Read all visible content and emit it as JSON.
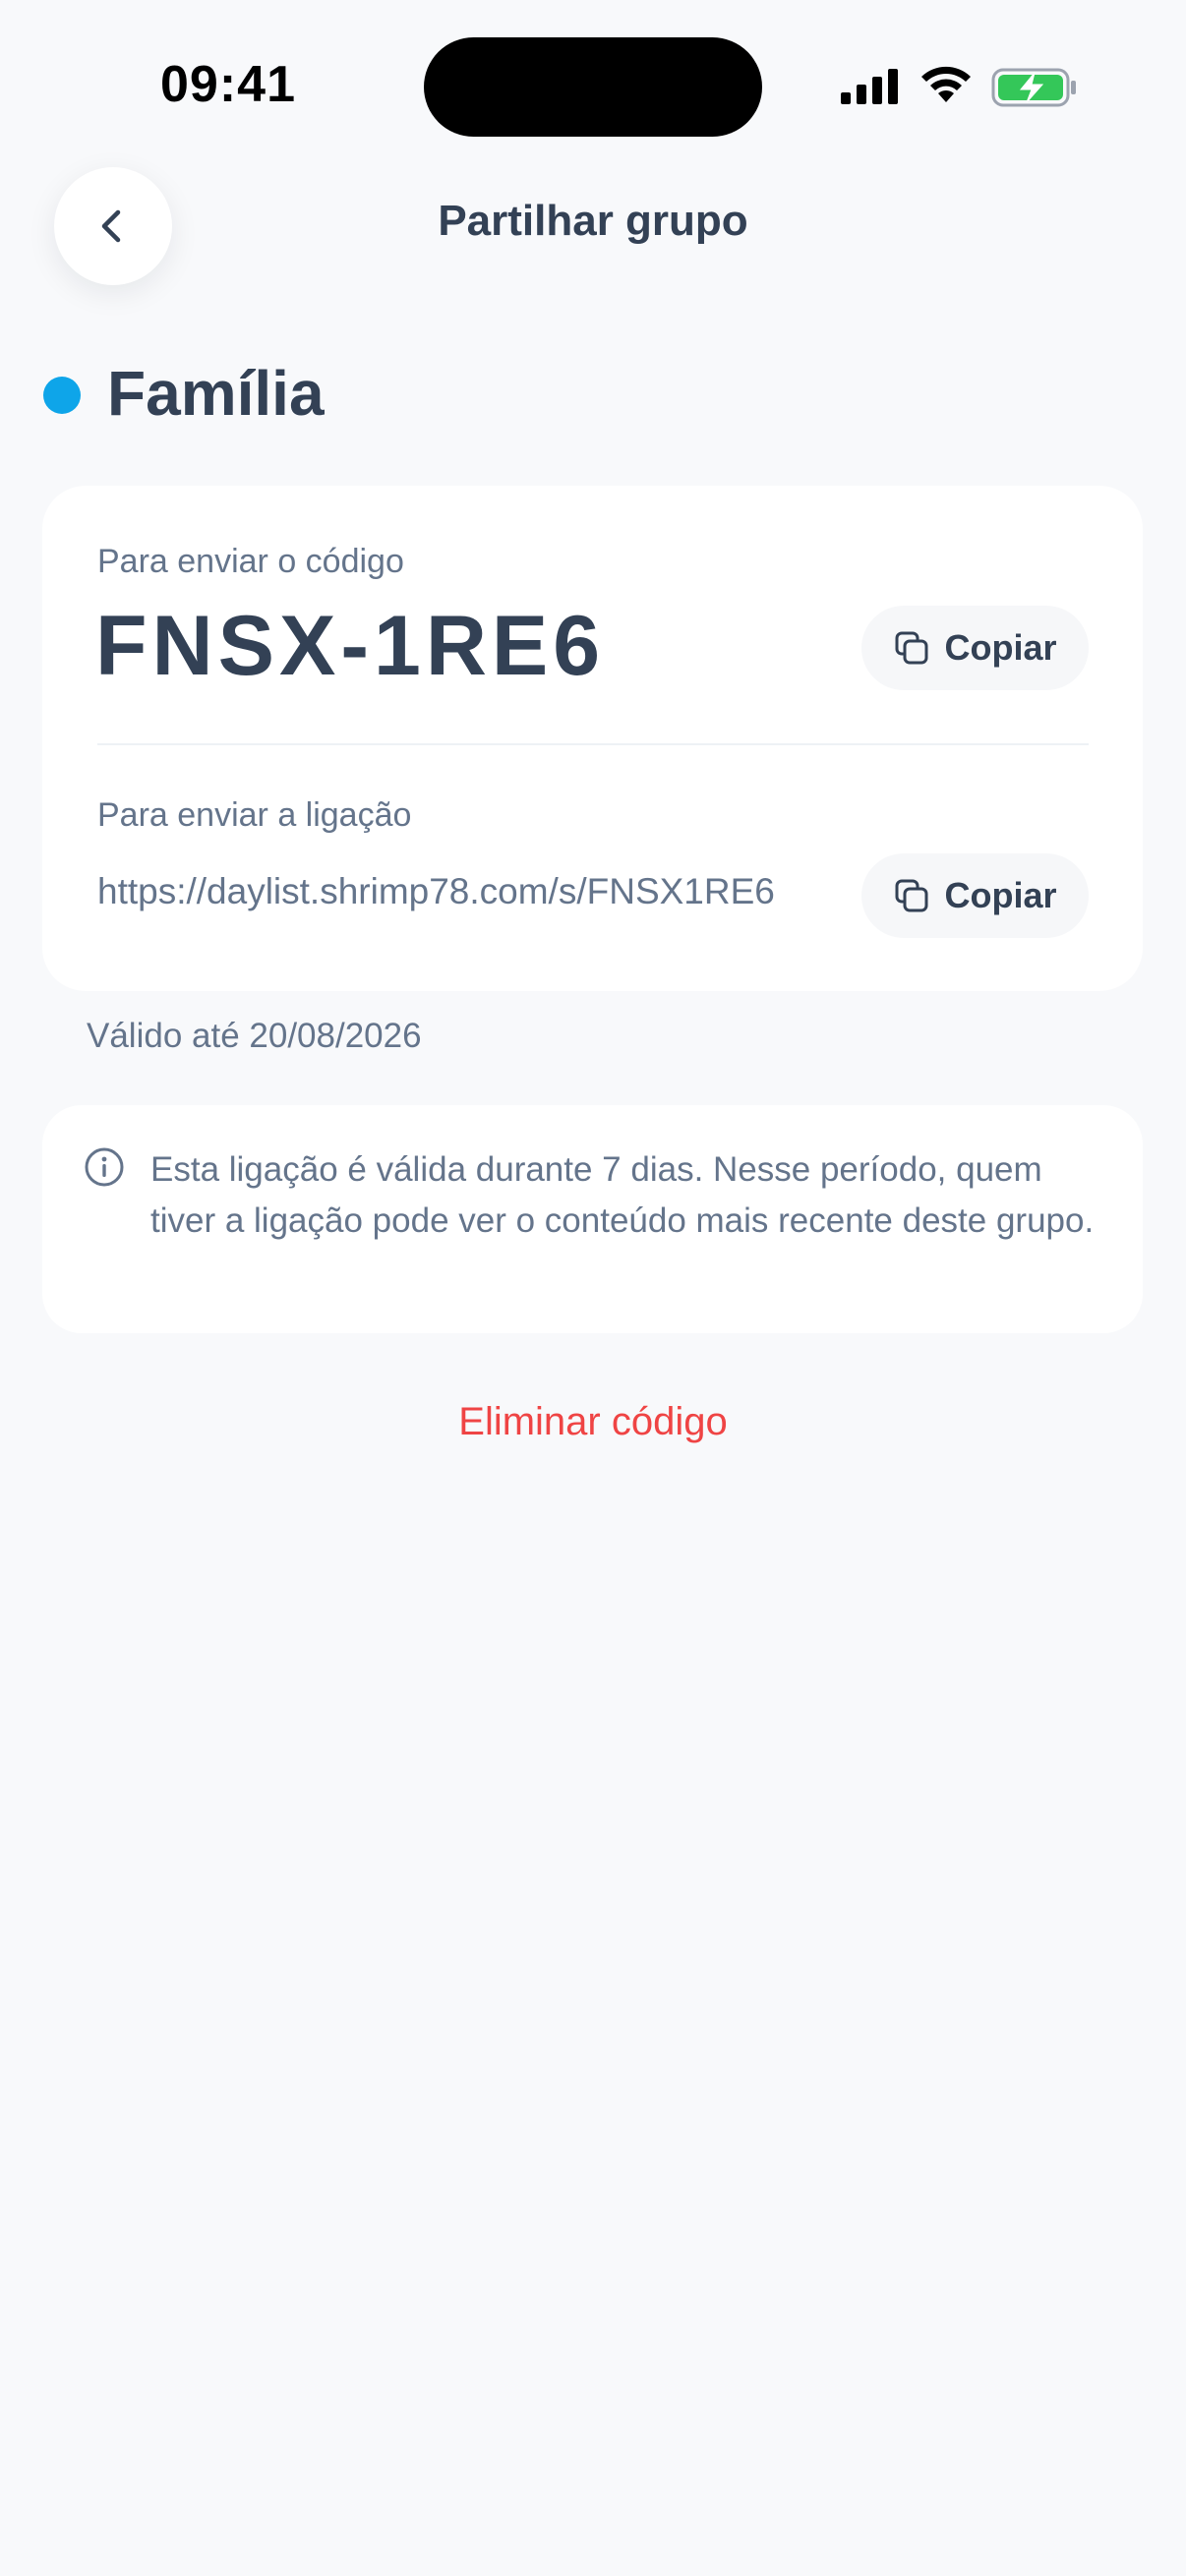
{
  "status_bar": {
    "time": "09:41"
  },
  "header": {
    "title": "Partilhar grupo",
    "back_icon": "chevron-left-icon"
  },
  "group": {
    "name": "Família",
    "color": "#0ea5e9"
  },
  "share_card": {
    "code_label": "Para enviar o código",
    "code": "FNSX-1RE6",
    "copy_code_label": "Copiar",
    "link_label": "Para enviar a ligação",
    "link": "https://daylist.shrimp78.com/s/FNSX1RE6",
    "copy_link_label": "Copiar",
    "copy_icon": "copy-icon"
  },
  "valid_until": "Válido até 20/08/2026",
  "info": {
    "icon": "info-icon",
    "text": "Esta ligação é válida durante 7 dias. Nesse período, quem tiver a ligação pode ver o conteúdo mais recente deste grupo."
  },
  "actions": {
    "delete_code_label": "Eliminar código",
    "delete_color": "#ef4444"
  }
}
